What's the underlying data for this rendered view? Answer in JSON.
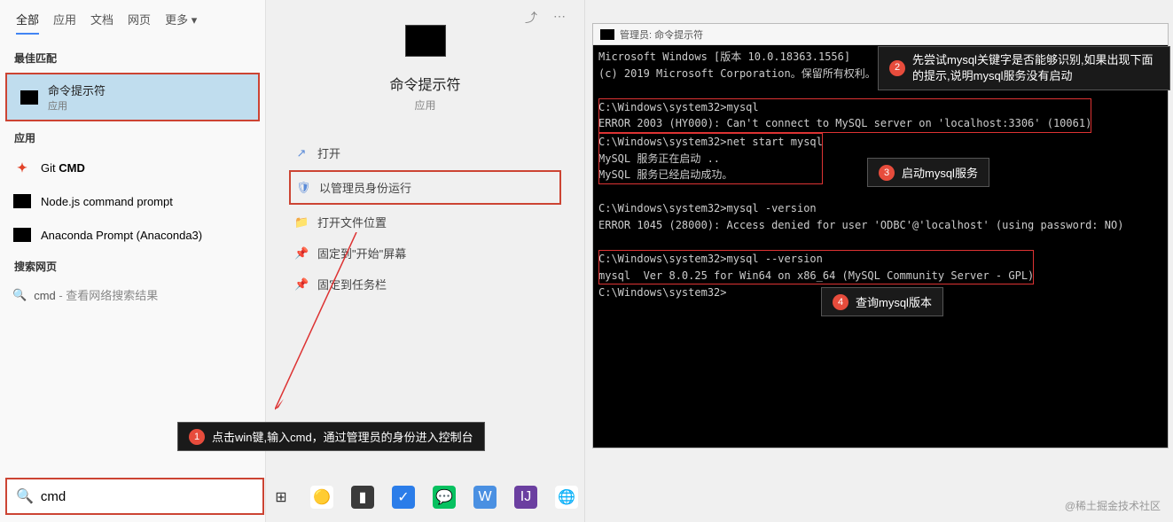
{
  "search": {
    "tabs": [
      "全部",
      "应用",
      "文档",
      "网页",
      "更多"
    ],
    "active_tab": "全部",
    "section_best": "最佳匹配",
    "section_apps": "应用",
    "section_web": "搜索网页",
    "best_match": {
      "title": "命令提示符",
      "sub": "应用"
    },
    "apps": [
      {
        "title_pre": "Git ",
        "title_bold": "CMD"
      },
      {
        "title": "Node.js command prompt"
      },
      {
        "title": "Anaconda Prompt (Anaconda3)"
      }
    ],
    "web": {
      "query": "cmd",
      "hint": " - 查看网络搜索结果"
    },
    "input_value": "cmd"
  },
  "preview": {
    "title": "命令提示符",
    "sub": "应用",
    "actions": [
      {
        "icon": "↗",
        "label": "打开"
      },
      {
        "icon": "🛡",
        "label": "以管理员身份运行",
        "hl": true
      },
      {
        "icon": "📁",
        "label": "打开文件位置"
      },
      {
        "icon": "📌",
        "label": "固定到\"开始\"屏幕"
      },
      {
        "icon": "📌",
        "label": "固定到任务栏"
      }
    ]
  },
  "cmd_window": {
    "title": "管理员: 命令提示符",
    "lines": [
      "Microsoft Windows [版本 10.0.18363.1556]",
      "(c) 2019 Microsoft Corporation。保留所有权利。",
      "",
      "C:\\Windows\\system32>mysql",
      "ERROR 2003 (HY000): Can't connect to MySQL server on 'localhost:3306' (10061)",
      "",
      "C:\\Windows\\system32>net start mysql",
      "MySQL 服务正在启动 ..",
      "MySQL 服务已经启动成功。",
      "",
      "",
      "C:\\Windows\\system32>mysql -version",
      "ERROR 1045 (28000): Access denied for user 'ODBC'@'localhost' (using password: NO)",
      "",
      "C:\\Windows\\system32>mysql --version",
      "mysql  Ver 8.0.25 for Win64 on x86_64 (MySQL Community Server - GPL)",
      "",
      "C:\\Windows\\system32>"
    ]
  },
  "callouts": {
    "c1": {
      "num": "1",
      "text": "点击win键,输入cmd，通过管理员的身份进入控制台"
    },
    "c2": {
      "num": "2",
      "text": "先尝试mysql关键字是否能够识别,如果出现下面的提示,说明mysql服务没有启动"
    },
    "c3": {
      "num": "3",
      "text": "启动mysql服务"
    },
    "c4": {
      "num": "4",
      "text": "查询mysql版本"
    }
  },
  "watermark": "@稀土掘金技术社区"
}
